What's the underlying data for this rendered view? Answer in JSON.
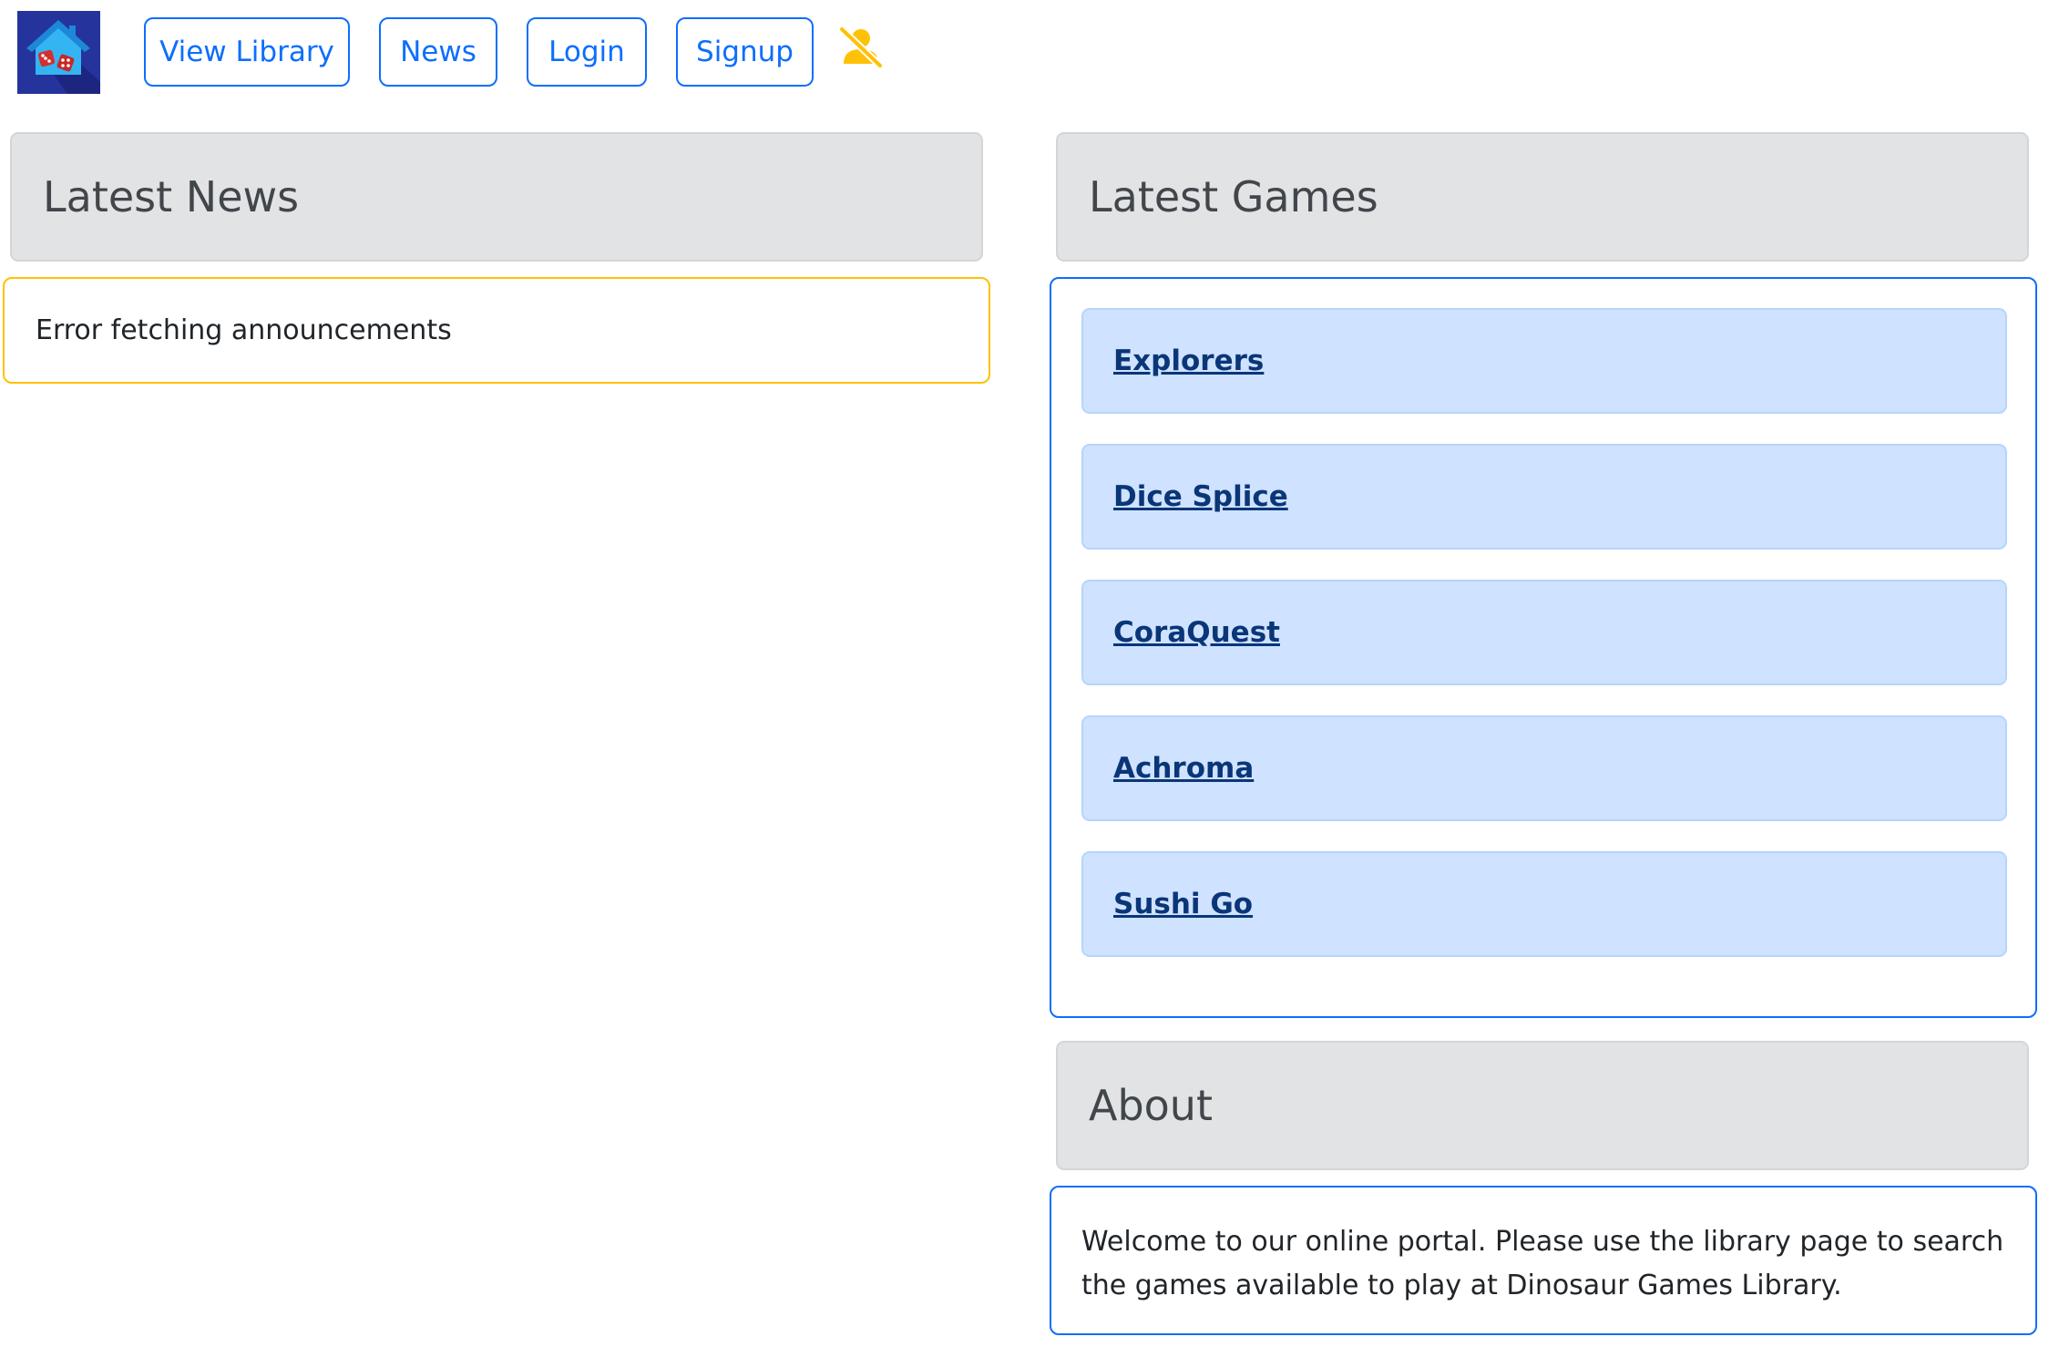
{
  "nav": {
    "logo_alt": "Dinosaur Games Library home",
    "buttons": {
      "view_library": "View Library",
      "news": "News",
      "login": "Login",
      "signup": "Signup"
    },
    "status_icon": "user-slash-icon"
  },
  "news": {
    "heading": "Latest News",
    "message": "Error fetching announcements"
  },
  "games": {
    "heading": "Latest Games",
    "items": [
      {
        "title": "Explorers"
      },
      {
        "title": "Dice Splice"
      },
      {
        "title": "CoraQuest"
      },
      {
        "title": "Achroma"
      },
      {
        "title": "Sushi Go"
      }
    ]
  },
  "about": {
    "heading": "About",
    "text": "Welcome to our online portal. Please use the library page to search the games available to play at Dinosaur Games Library."
  },
  "colors": {
    "primary": "#0d6efd",
    "warning": "#ffc107",
    "header_bg": "#e2e3e5",
    "game_bg": "#cfe2ff",
    "game_link": "#0a3678",
    "logo_bg": "#25349c"
  }
}
